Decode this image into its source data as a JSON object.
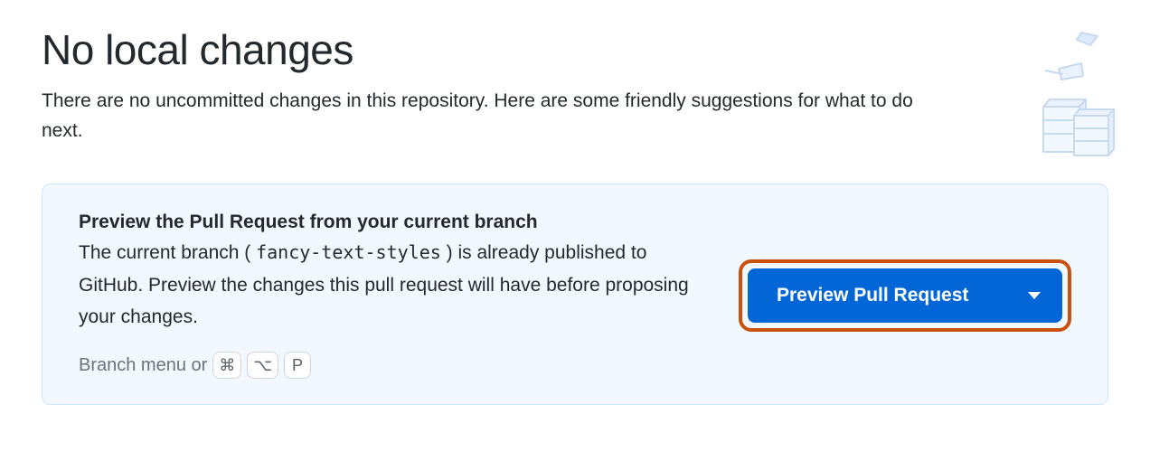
{
  "header": {
    "title": "No local changes",
    "subtitle": "There are no uncommitted changes in this repository. Here are some friendly suggestions for what to do next."
  },
  "suggestion": {
    "title": "Preview the Pull Request from your current branch",
    "desc_prefix": "The current branch ( ",
    "branch_name": "fancy-text-styles",
    "desc_suffix": " ) is already published to GitHub. Preview the changes this pull request will have before proposing your changes.",
    "hint_label": "Branch menu or",
    "shortcut_keys": [
      "⌘",
      "⌥",
      "P"
    ],
    "button_label": "Preview Pull Request"
  }
}
